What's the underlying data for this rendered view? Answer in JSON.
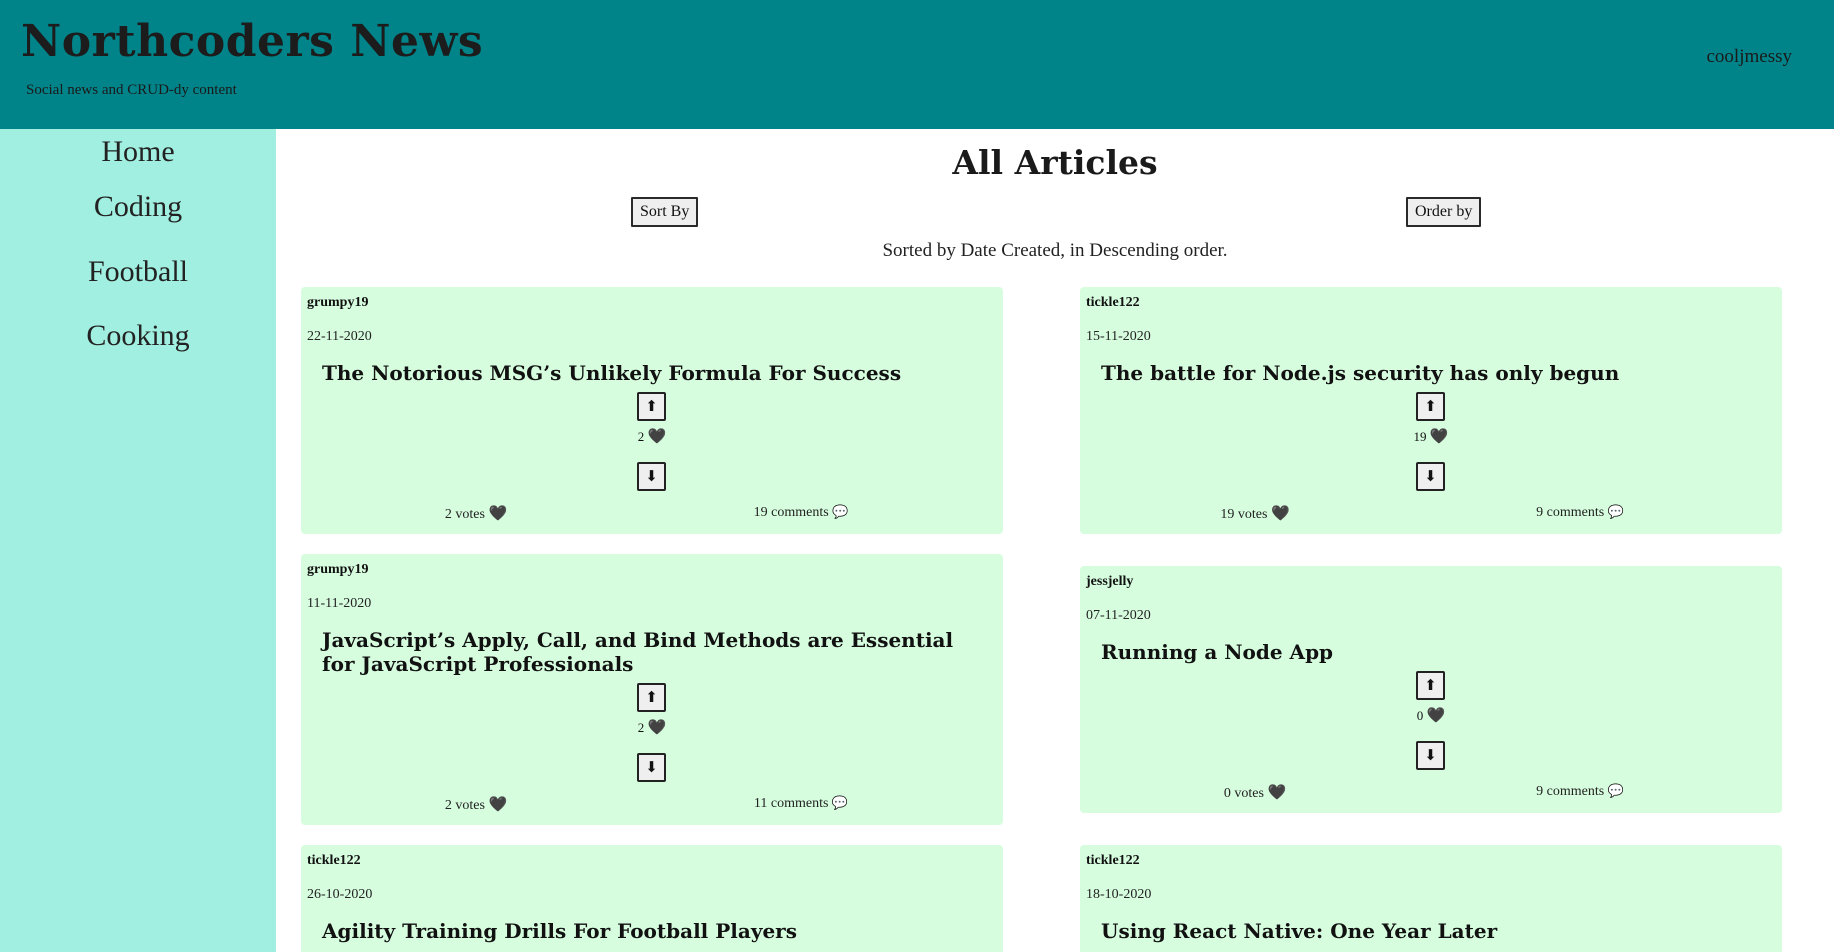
{
  "header": {
    "title": "Northcoders News",
    "tagline": "Social news and CRUD-dy content",
    "username": "cooljmessy"
  },
  "sidebar": {
    "items": [
      {
        "label": "Home"
      },
      {
        "label": "Coding"
      },
      {
        "label": "Football"
      },
      {
        "label": "Cooking"
      }
    ]
  },
  "main": {
    "title": "All Articles",
    "sort_label": "Sort By",
    "order_label": "Order by",
    "status": "Sorted by Date Created, in Descending order."
  },
  "icons": {
    "up": "⬆",
    "down": "⬇",
    "heart": "🖤",
    "comment": "💬"
  },
  "articles": [
    {
      "author": "grumpy19",
      "date": "22-11-2020",
      "title": "The Notorious MSG’s Unlikely Formula For Success",
      "vote_count": "2",
      "votes": "2 votes",
      "comments": "19 comments"
    },
    {
      "author": "tickle122",
      "date": "15-11-2020",
      "title": "The battle for Node.js security has only begun",
      "vote_count": "19",
      "votes": "19 votes",
      "comments": "9 comments"
    },
    {
      "author": "grumpy19",
      "date": "11-11-2020",
      "title": "JavaScript’s Apply, Call, and Bind Methods are Essential for JavaScript Professionals",
      "vote_count": "2",
      "votes": "2 votes",
      "comments": "11 comments"
    },
    {
      "author": "jessjelly",
      "date": "07-11-2020",
      "title": "Running a Node App",
      "vote_count": "0",
      "votes": "0 votes",
      "comments": "9 comments"
    },
    {
      "author": "tickle122",
      "date": "26-10-2020",
      "title": "Agility Training Drills For Football Players"
    },
    {
      "author": "tickle122",
      "date": "18-10-2020",
      "title": "Using React Native: One Year Later"
    }
  ]
}
